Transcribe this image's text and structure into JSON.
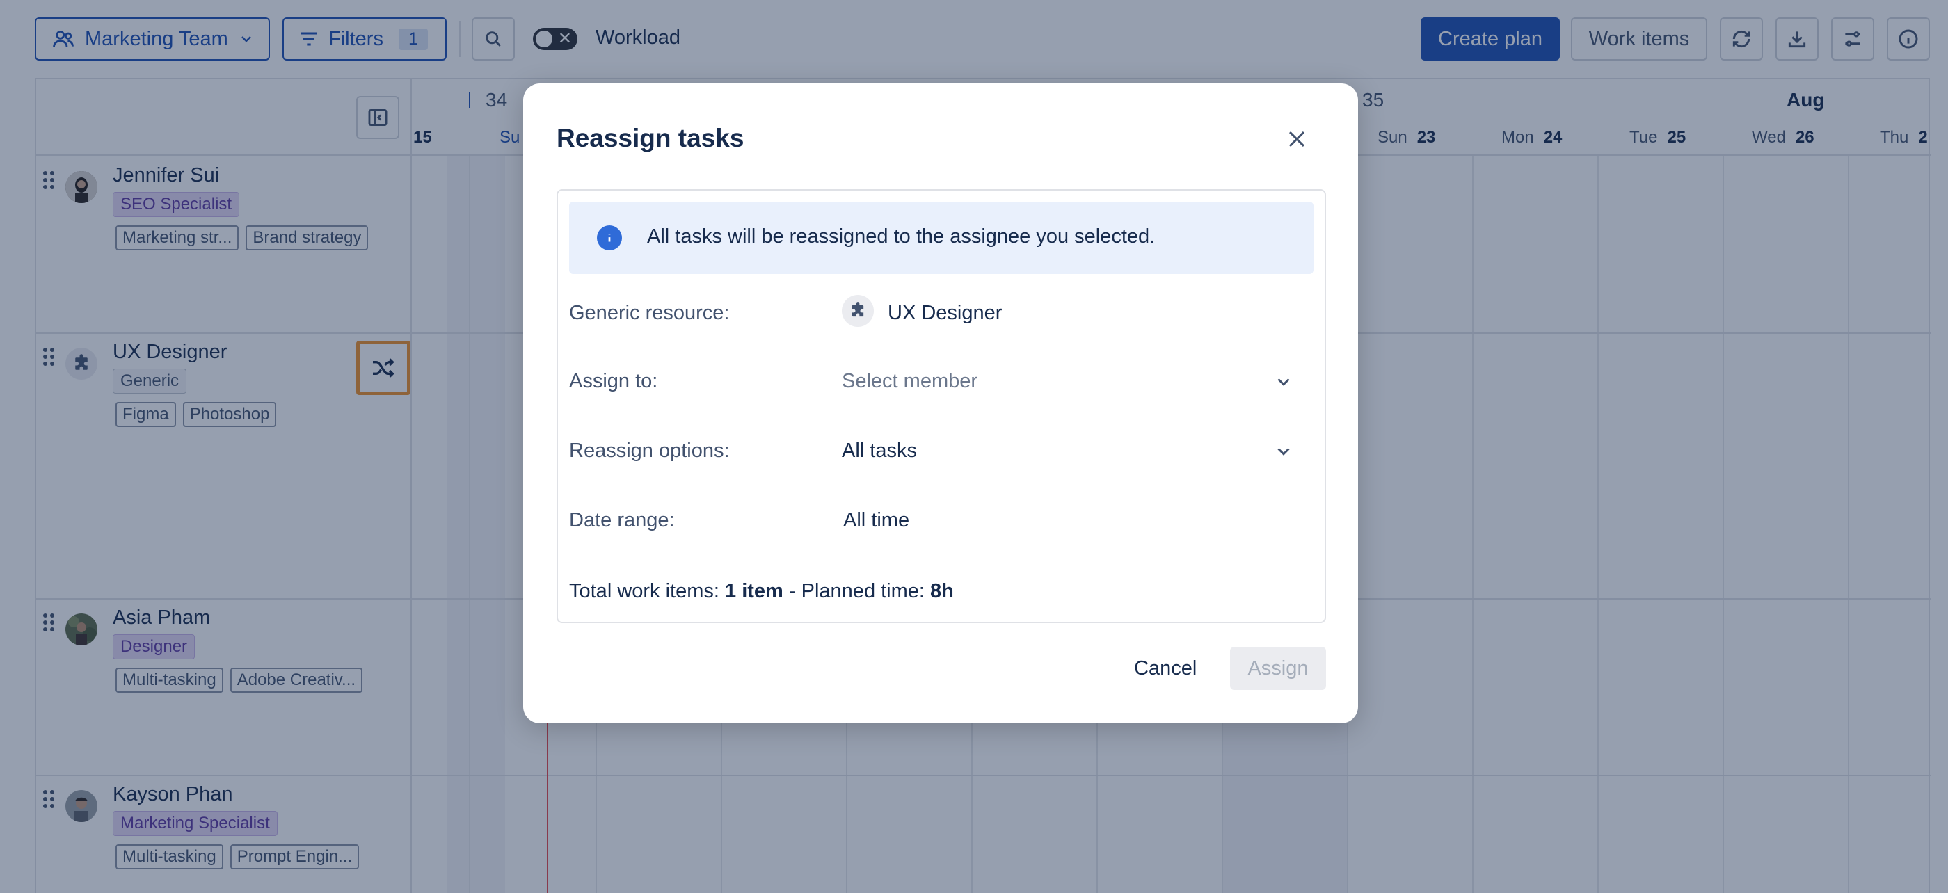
{
  "toolbar": {
    "team_label": "Marketing Team",
    "filters_label": "Filters",
    "filters_count": "1",
    "workload_label": "Workload",
    "create_plan_label": "Create plan",
    "work_items_label": "Work items"
  },
  "timeline": {
    "weeks": [
      "34",
      "35"
    ],
    "month": "Aug",
    "partial_day_num": "15",
    "partial_day_name": "Su",
    "days": [
      {
        "name": "Sun",
        "num": "23"
      },
      {
        "name": "Mon",
        "num": "24"
      },
      {
        "name": "Tue",
        "num": "25"
      },
      {
        "name": "Wed",
        "num": "26"
      },
      {
        "name": "Thu",
        "num": "2"
      }
    ]
  },
  "people": [
    {
      "name": "Jennifer Sui",
      "role": "SEO Specialist",
      "skills": [
        "Marketing str...",
        "Brand strategy"
      ]
    },
    {
      "name": "UX Designer",
      "role": "Generic",
      "skills": [
        "Figma",
        "Photoshop"
      ]
    },
    {
      "name": "Asia Pham",
      "role": "Designer",
      "skills": [
        "Multi-tasking",
        "Adobe Creativ..."
      ]
    },
    {
      "name": "Kayson Phan",
      "role": "Marketing Specialist",
      "skills": [
        "Multi-tasking",
        "Prompt Engin..."
      ]
    }
  ],
  "modal": {
    "title": "Reassign tasks",
    "info": "All tasks will be reassigned to the assignee you selected.",
    "generic_resource_label": "Generic resource:",
    "generic_resource_value": "UX Designer",
    "assign_to_label": "Assign to:",
    "assign_to_placeholder": "Select member",
    "reassign_options_label": "Reassign options:",
    "reassign_options_value": "All tasks",
    "date_range_label": "Date range:",
    "date_range_value": "All time",
    "total_label": "Total work items:",
    "total_value": "1 item",
    "separator": "-",
    "planned_label": "Planned time:",
    "planned_value": "8h",
    "cancel_label": "Cancel",
    "assign_label": "Assign"
  },
  "colors": {
    "primary": "#1d4fb3",
    "role_tag_purple": "#e6d9f5",
    "highlight_border": "#f0922b",
    "today_line": "#e5484d"
  }
}
